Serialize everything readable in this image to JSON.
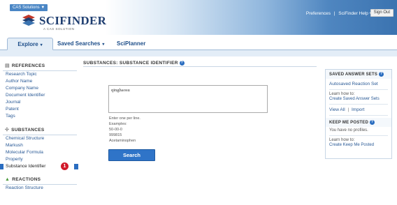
{
  "header": {
    "cas_badge": "CAS Solutions ▼",
    "logo_text": "SCIFINDER",
    "logo_sub": "A CAS SOLUTION",
    "links": [
      "Preferences",
      "SciFinder Help ▾"
    ],
    "separator": "|",
    "signout": "Sign Out"
  },
  "nav": {
    "tabs": [
      {
        "label": "Explore",
        "caret": "▾"
      },
      {
        "label": "Saved Searches",
        "caret": "▾"
      },
      {
        "label": "SciPlanner",
        "caret": ""
      }
    ]
  },
  "sidebar": {
    "sections": [
      {
        "heading": "REFERENCES",
        "icon": "references-icon",
        "items": [
          "Research Topic",
          "Author Name",
          "Company Name",
          "Document Identifier",
          "Journal",
          "Patent",
          "Tags"
        ]
      },
      {
        "heading": "SUBSTANCES",
        "icon": "substances-icon",
        "items": [
          "Chemical Structure",
          "Markush",
          "Molecular Formula",
          "Property",
          "Substance Identifier"
        ]
      },
      {
        "heading": "REACTIONS",
        "icon": "reactions-icon",
        "items": [
          "Reaction Structure"
        ]
      }
    ],
    "annotation_badge": "1"
  },
  "main": {
    "title": "SUBSTANCES: SUBSTANCE IDENTIFIER",
    "help": "?",
    "input_value": "qinghaosu",
    "hint_lines": [
      "Enter one per line.",
      "Examples:",
      "50-00-0",
      "999815",
      "Acetaminophen"
    ],
    "search_label": "Search"
  },
  "right_panel": {
    "saved_heading": "SAVED ANSWER SETS",
    "autosaved": "Autosaved Reaction Set",
    "learn_how": "Learn how to:",
    "create_saved": "Create Saved Answer Sets",
    "view_all": "View All",
    "separator": "|",
    "import": "Import",
    "posted_heading": "KEEP ME POSTED",
    "no_profiles": "You have no profiles.",
    "learn_how2": "Learn how to:",
    "create_keep": "Create Keep Me Posted"
  }
}
